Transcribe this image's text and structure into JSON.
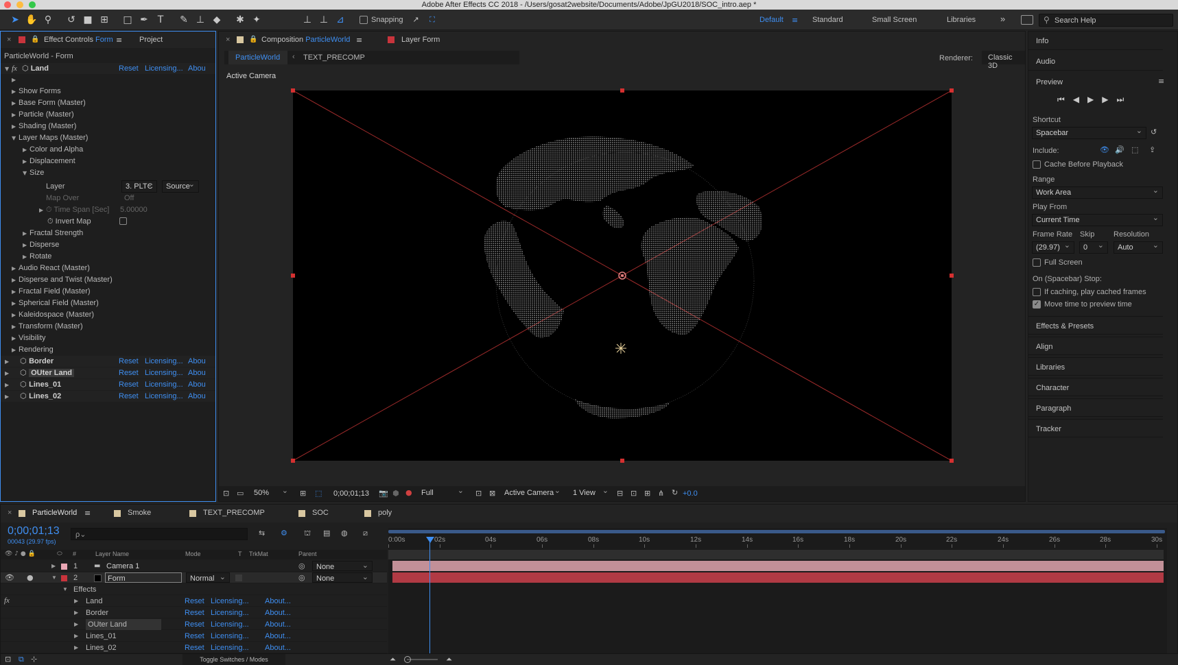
{
  "window": {
    "title": "Adobe After Effects CC 2018 - /Users/gosat2website/Documents/Adobe/JpGU2018/SOC_intro.aep *"
  },
  "toolbar": {
    "snapping": "Snapping",
    "workspaces": [
      "Default",
      "Standard",
      "Small Screen",
      "Libraries"
    ],
    "search_placeholder": "Search Help",
    "more": "»"
  },
  "effect_controls": {
    "tab_label": "Effect Controls",
    "tab_layer": "Form",
    "tab_project": "Project",
    "header": "ParticleWorld - Form",
    "reset": "Reset",
    "licensing": "Licensing...",
    "about": "Abou",
    "effect_name": "Land",
    "tree": [
      {
        "label": "",
        "indent": 1
      },
      {
        "label": "Show Forms",
        "indent": 1
      },
      {
        "label": "Base Form (Master)",
        "indent": 1
      },
      {
        "label": "Particle (Master)",
        "indent": 1
      },
      {
        "label": "Shading (Master)",
        "indent": 1
      },
      {
        "label": "Layer Maps (Master)",
        "indent": 1,
        "open": true
      },
      {
        "label": "Color and Alpha",
        "indent": 2
      },
      {
        "label": "Displacement",
        "indent": 2
      },
      {
        "label": "Size",
        "indent": 2,
        "open": true
      }
    ],
    "layer_label": "Layer",
    "layer_value": "3. PLTC",
    "layer_source": "Source",
    "map_over_label": "Map Over",
    "map_over_value": "Off",
    "time_span_label": "Time Span [Sec]",
    "time_span_value": "5.00000",
    "invert_map_label": "Invert Map",
    "tree2": [
      {
        "label": "Fractal Strength",
        "indent": 2
      },
      {
        "label": "Disperse",
        "indent": 2
      },
      {
        "label": "Rotate",
        "indent": 2
      },
      {
        "label": "Audio React (Master)",
        "indent": 1
      },
      {
        "label": "Disperse and Twist (Master)",
        "indent": 1
      },
      {
        "label": "Fractal Field (Master)",
        "indent": 1
      },
      {
        "label": "Spherical Field (Master)",
        "indent": 1
      },
      {
        "label": "Kaleidospace (Master)",
        "indent": 1
      },
      {
        "label": "Transform (Master)",
        "indent": 1
      },
      {
        "label": "Visibility",
        "indent": 1
      },
      {
        "label": "Rendering",
        "indent": 1
      }
    ],
    "effects": [
      "Border",
      "OUter Land",
      "Lines_01",
      "Lines_02"
    ]
  },
  "composition": {
    "tab_label": "Composition",
    "tab_name": "ParticleWorld",
    "layer_tab": "Layer Form",
    "breadcrumb": [
      "ParticleWorld",
      "TEXT_PRECOMP"
    ],
    "renderer_label": "Renderer:",
    "renderer_value": "Classic 3D",
    "view_label": "Active Camera",
    "footer": {
      "zoom": "50%",
      "timecode": "0;00;01;13",
      "resolution": "Full",
      "camera": "Active Camera",
      "views": "1 View",
      "exposure": "+0.0"
    }
  },
  "right_panel": {
    "info": "Info",
    "audio": "Audio",
    "preview": "Preview",
    "shortcut_label": "Shortcut",
    "shortcut_value": "Spacebar",
    "include_label": "Include:",
    "cache_before": "Cache Before Playback",
    "range_label": "Range",
    "range_value": "Work Area",
    "play_from_label": "Play From",
    "play_from_value": "Current Time",
    "frame_rate_label": "Frame Rate",
    "frame_rate_value": "(29.97)",
    "skip_label": "Skip",
    "skip_value": "0",
    "resolution_label": "Resolution",
    "resolution_value": "Auto",
    "full_screen": "Full Screen",
    "stop_label": "On (Spacebar) Stop:",
    "if_caching": "If caching, play cached frames",
    "move_time": "Move time to preview time",
    "panels": [
      "Effects & Presets",
      "Align",
      "Libraries",
      "Character",
      "Paragraph",
      "Tracker"
    ]
  },
  "timeline": {
    "tabs": [
      "ParticleWorld",
      "Smoke",
      "TEXT_PRECOMP",
      "SOC",
      "poly"
    ],
    "timecode": "0;00;01;13",
    "frames": "00043 (29.97 fps)",
    "search_placeholder": "ρ⌄",
    "columns": {
      "layer_name": "Layer Name",
      "mode": "Mode",
      "t": "T",
      "trkmat": "TrkMat",
      "parent": "Parent",
      "num": "#"
    },
    "layers": [
      {
        "num": "1",
        "name": "Camera 1",
        "parent": "None"
      },
      {
        "num": "2",
        "name": "Form",
        "mode": "Normal",
        "parent": "None"
      }
    ],
    "effects_label": "Effects",
    "effects": [
      "Land",
      "Border",
      "OUter Land",
      "Lines_01",
      "Lines_02"
    ],
    "reset": "Reset",
    "licensing": "Licensing...",
    "about": "About...",
    "ruler": [
      "0:00s",
      "02s",
      "04s",
      "06s",
      "08s",
      "10s",
      "12s",
      "14s",
      "16s",
      "18s",
      "20s",
      "22s",
      "24s",
      "26s",
      "28s",
      "30s"
    ],
    "toggle": "Toggle Switches / Modes"
  },
  "colors": {
    "accent": "#3f8ff2",
    "label_red": "#c8343c",
    "label_pink": "#e9a6b4",
    "bar_red": "#b13a44",
    "bar_pink": "#c29098"
  }
}
